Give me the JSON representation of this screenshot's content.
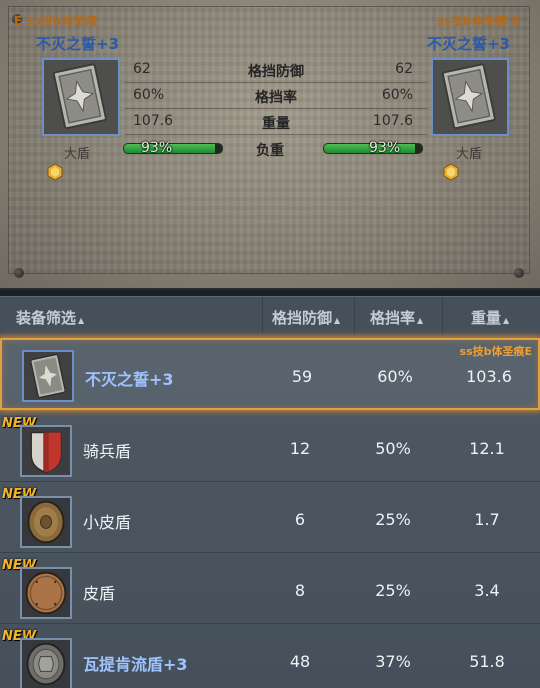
{
  "compare": {
    "left": {
      "set_label": "E ss技b体圣痕",
      "title": "不灭之誓+3",
      "category": "大盾",
      "values": [
        "62",
        "60%",
        "107.6"
      ],
      "load_pct": "93%",
      "load_fraction": 0.93
    },
    "right": {
      "set_label": "ss技b体圣痕 E",
      "title": "不灭之誓+3",
      "category": "大盾",
      "values": [
        "62",
        "60%",
        "107.6"
      ],
      "load_pct": "93%",
      "load_fraction": 0.93
    },
    "stat_names": [
      "格挡防御",
      "格挡率",
      "重量"
    ],
    "load_name": "负重"
  },
  "list": {
    "headers": {
      "filter": "装备筛选",
      "block_def": "格挡防御",
      "block_rate": "格挡率",
      "weight": "重量"
    },
    "rows": [
      {
        "name": "不灭之誓+3",
        "block_def": "59",
        "block_rate": "60%",
        "weight": "103.6",
        "new": "",
        "set": "ss技b体圣痕E",
        "selected": true,
        "highlight": true
      },
      {
        "name": "骑兵盾",
        "block_def": "12",
        "block_rate": "50%",
        "weight": "12.1",
        "new": "NEW",
        "set": "",
        "selected": false,
        "highlight": false
      },
      {
        "name": "小皮盾",
        "block_def": "6",
        "block_rate": "25%",
        "weight": "1.7",
        "new": "NEW",
        "set": "",
        "selected": false,
        "highlight": false
      },
      {
        "name": "皮盾",
        "block_def": "8",
        "block_rate": "25%",
        "weight": "3.4",
        "new": "NEW",
        "set": "",
        "selected": false,
        "highlight": false
      },
      {
        "name": "瓦提肯流盾+3",
        "block_def": "48",
        "block_rate": "37%",
        "weight": "51.8",
        "new": "NEW",
        "set": "",
        "selected": false,
        "highlight": true
      }
    ]
  },
  "colors": {
    "accent_orange": "#e0a040",
    "name_blue": "#2a5aa8",
    "load_green": "#2fa43d",
    "new_tag": "#f3b42a"
  },
  "icons": [
    "greatshield-icon",
    "heater-shield-icon",
    "buckler-icon",
    "round-shield-icon",
    "spiked-round-shield-icon",
    "gem-icon",
    "sort-arrow-icon"
  ]
}
